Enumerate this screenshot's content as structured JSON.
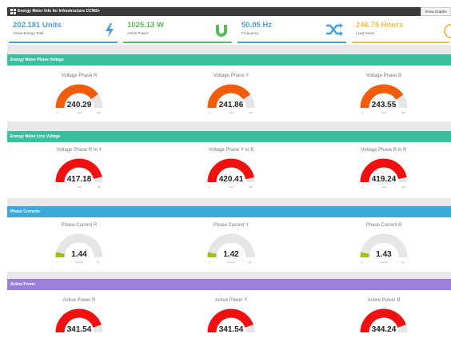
{
  "header": {
    "title": "Energy Meter Info for Infrastructure CCMS+",
    "button_label": "Show Graphs"
  },
  "stats": [
    {
      "value": "202.181 Units",
      "label": "Active Energy Total",
      "color": "#4a9fd8",
      "icon": "lightning-icon"
    },
    {
      "value": "1025.13 W",
      "label": "Active Power",
      "color": "#5cb85c",
      "icon": "magnet-icon"
    },
    {
      "value": "50.05 Hz",
      "label": "Frequency",
      "color": "#4a9fd8",
      "icon": "shuffle-icon"
    },
    {
      "value": "246.75 Hours",
      "label": "Load Hours",
      "color": "#f0c040",
      "icon": "clock-icon"
    }
  ],
  "sections": [
    {
      "title": "Energy Meter Phase Voltage",
      "color": "#3bbf9c",
      "gauges": [
        {
          "title": "Voltage Phase R",
          "value": "240.29",
          "num": 240.29,
          "min": "0",
          "max": "300",
          "unit": "Volts",
          "color": "#f25c0c"
        },
        {
          "title": "Voltage Phase Y",
          "value": "241.86",
          "num": 241.86,
          "min": "0",
          "max": "300",
          "unit": "Volts",
          "color": "#f25c0c"
        },
        {
          "title": "Voltage Phase B",
          "value": "243.55",
          "num": 243.55,
          "min": "0",
          "max": "300",
          "unit": "Volts",
          "color": "#f25c0c"
        }
      ]
    },
    {
      "title": "Energy Meter Line Voltage",
      "color": "#3bbf9c",
      "gauges": [
        {
          "title": "Voltage Phase R to Y",
          "value": "417.18",
          "num": 417.18,
          "min": "0",
          "max": "450",
          "unit": "Volts",
          "color": "#f01010"
        },
        {
          "title": "Voltage Phase Y to B",
          "value": "420.41",
          "num": 420.41,
          "min": "0",
          "max": "450",
          "unit": "Volts",
          "color": "#f01010"
        },
        {
          "title": "Voltage Phase B to R",
          "value": "419.24",
          "num": 419.24,
          "min": "0",
          "max": "450",
          "unit": "Volts",
          "color": "#f01010"
        }
      ]
    },
    {
      "title": "Phase Currents",
      "color": "#3ba9d9",
      "gauges": [
        {
          "title": "Phase Current R",
          "value": "1.44",
          "num": 1.44,
          "min": "0",
          "max": "20",
          "unit": "Ampere",
          "color": "#9ac21a"
        },
        {
          "title": "Phase Current Y",
          "value": "1.42",
          "num": 1.42,
          "min": "0",
          "max": "20",
          "unit": "Ampere",
          "color": "#9ac21a"
        },
        {
          "title": "Phase Current B",
          "value": "1.43",
          "num": 1.43,
          "min": "0",
          "max": "20",
          "unit": "Ampere",
          "color": "#9ac21a"
        }
      ]
    },
    {
      "title": "Active Power",
      "color": "#9b7fd9",
      "gauges": [
        {
          "title": "Active Power R",
          "value": "341.54",
          "num": 341.54,
          "min": "",
          "max": "",
          "unit": "",
          "color": "#f01010"
        },
        {
          "title": "Active Power Y",
          "value": "341.54",
          "num": 341.54,
          "min": "",
          "max": "",
          "unit": "",
          "color": "#f01010"
        },
        {
          "title": "Active Power B",
          "value": "344.24",
          "num": 344.24,
          "min": "",
          "max": "",
          "unit": "",
          "color": "#f01010"
        }
      ]
    }
  ]
}
